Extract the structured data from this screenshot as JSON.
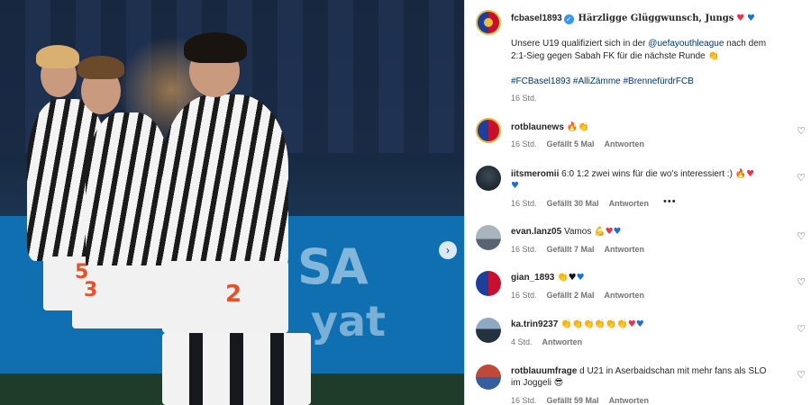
{
  "post": {
    "author": "fcbasel1893",
    "title": "Härzligge Glüggwunsch, Jungs",
    "title_emojis": [
      "heart-red",
      "heart-blue"
    ],
    "body_pre": "Unsere U19 qualifiziert sich in der ",
    "body_mention": "@uefayouthleague",
    "body_post": " nach dem",
    "body_line2": "2:1-Sieg gegen Sabah FK für die nächste Runde",
    "hashtags": "#FCBasel1893 #AlliZämme #BrennefürdrFCB",
    "time": "16 Std."
  },
  "photo": {
    "board_text_1": "SA",
    "board_text_2": "yat",
    "shirt_numbers": [
      "5",
      "3",
      "2"
    ],
    "next_icon": "›"
  },
  "comments": [
    {
      "user": "rotblaunews",
      "text": "",
      "emojis": "🔥 👏",
      "time": "16 Std.",
      "likes": "Gefällt 5 Mal",
      "reply": "Antworten",
      "avatar": "fcb-crest"
    },
    {
      "user": "iitsmeromii",
      "text": "6:0 1:2 zwei wins für die wo's interessiert :)",
      "emojis": "🔥 ❤",
      "line2": "💙",
      "time": "16 Std.",
      "likes": "Gefällt 30 Mal",
      "reply": "Antworten",
      "more": "•••",
      "avatar": "dark"
    },
    {
      "user": "evan.lanz05",
      "text": "Vamos",
      "emojis": "💪 ❤ 💙",
      "time": "16 Std.",
      "likes": "Gefällt 7 Mal",
      "reply": "Antworten",
      "avatar": "car"
    },
    {
      "user": "gian_1893",
      "text": "",
      "emojis": "👏 🖤 💙",
      "time": "16 Std.",
      "likes": "Gefällt 2 Mal",
      "reply": "Antworten",
      "avatar": "fcb"
    },
    {
      "user": "ka.trin9237",
      "text": "",
      "emojis": "👏 👏 👏 👏 👏 👏 ❤ 💙",
      "time": "4 Std.",
      "likes": "",
      "reply": "Antworten",
      "avatar": "sky"
    },
    {
      "user": "rotblauumfrage",
      "text": "d U21 in Aserbaidschan mit mehr fans als SLO",
      "line2": "im Joggeli 😎",
      "time": "16 Std.",
      "likes": "Gefällt 59 Mal",
      "reply": "Antworten",
      "avatar": "flag"
    }
  ],
  "icons": {
    "like": "heart-outline-icon",
    "verified": "verified-badge-icon"
  },
  "colors": {
    "link": "#00376b",
    "verified": "#3897f0",
    "meta": "#737373"
  }
}
